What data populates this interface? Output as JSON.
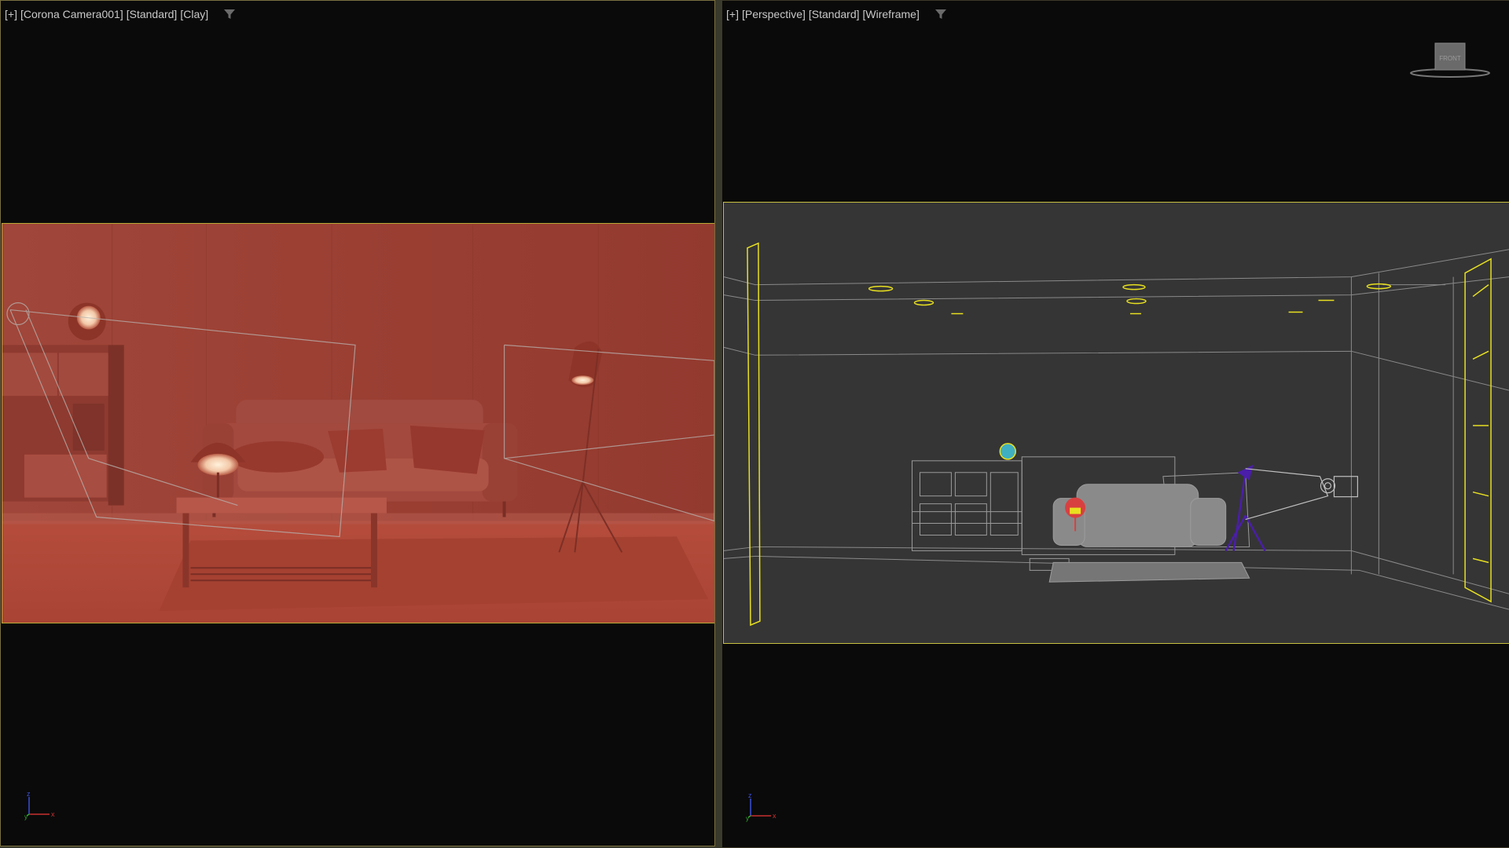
{
  "left_viewport": {
    "labels": [
      "[+]",
      "[Corona Camera001]",
      "[Standard]",
      "[Clay]"
    ],
    "filter_icon": "funnel-icon",
    "shading_color": "#9b3f32",
    "frame_color": "#b9a935"
  },
  "right_viewport": {
    "labels": [
      "[+]",
      "[Perspective]",
      "[Standard]",
      "[Wireframe]"
    ],
    "filter_icon": "funnel-icon",
    "viewcube_label": "FRONT",
    "background_color": "#353535",
    "frame_color": "#c8c040"
  },
  "axes": {
    "x": "x",
    "y": "y",
    "z": "z"
  },
  "colors": {
    "viewport_bg": "#0a0a0a",
    "active_border": "#7a7040",
    "light_color": "#e8e020"
  }
}
